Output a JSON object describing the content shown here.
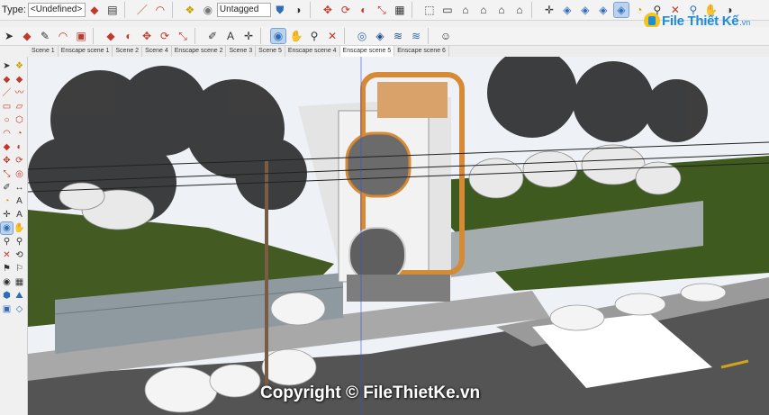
{
  "toolbar": {
    "type_label": "Type:",
    "type_value": "<Undefined>",
    "tag_value": "Untagged",
    "row1_icons": [
      "eraser-icon",
      "paint-bucket-icon",
      "line-tool-icon",
      "arc-tool-icon",
      "rectangle-icon",
      "circle-icon",
      "polygon-icon",
      "push-pull-icon",
      "move-icon",
      "rotate-icon",
      "scale-icon",
      "offset-icon",
      "follow-me-icon",
      "tape-measure-icon",
      "dimension-icon",
      "protractor-icon",
      "text-icon",
      "axes-icon",
      "3d-text-icon",
      "section-plane-icon",
      "iso-view-icon",
      "top-view-icon",
      "front-view-icon",
      "right-view-icon",
      "back-view-icon",
      "left-view-icon",
      "home-icon",
      "bottom-view-icon",
      "orbit-icon",
      "pan-icon",
      "zoom-icon",
      "zoom-window-icon",
      "zoom-extents-icon",
      "walk-icon",
      "look-around-icon",
      "position-camera-icon",
      "xray-icon",
      "shadows-icon",
      "fog-icon"
    ],
    "row2_icons": [
      "select-icon",
      "eraser-icon",
      "pencil-icon",
      "arc-icon",
      "shape-icon",
      "push-pull-icon",
      "move-icon",
      "rotate-icon",
      "scale-icon",
      "offset-icon",
      "tape-icon",
      "text-icon",
      "axes-icon",
      "orbit-icon",
      "pan-icon",
      "zoom-icon",
      "zoom-extents-icon",
      "previous-view-icon",
      "warehouse-icon",
      "extension-icon",
      "components-icon",
      "layers-icon",
      "account-icon"
    ]
  },
  "logo": {
    "text": "File Thiết Kế",
    "suffix": ".vn"
  },
  "scene_tabs": [
    "Scene 1",
    "Enscape scene 1",
    "Scene 2",
    "Scene 4",
    "Enscape scene 2",
    "Scene 3",
    "Scene 5",
    "Enscape scene 4",
    "Enscape scene 5",
    "Enscape scene 6"
  ],
  "selected_scene": "Enscape scene 5",
  "left_tools": [
    "select-icon",
    "component-icon",
    "paint-icon",
    "eraser-icon",
    "line-icon",
    "freehand-icon",
    "rectangle-icon",
    "rotated-rect-icon",
    "circle-icon",
    "polygon-icon",
    "arc-icon",
    "pie-icon",
    "push-pull-icon",
    "follow-me-icon",
    "move-icon",
    "rotate-icon",
    "scale-icon",
    "offset-icon",
    "tape-icon",
    "dimension-icon",
    "protractor-icon",
    "text-icon",
    "axes-icon",
    "3d-text-icon",
    "orbit-icon",
    "pan-icon",
    "zoom-icon",
    "zoom-window-icon",
    "zoom-extents-icon",
    "previous-icon",
    "position-camera-icon",
    "walk-icon",
    "look-around-icon",
    "section-icon",
    "sandbox-icon",
    "terrain-icon",
    "stamp-icon",
    "drape-icon"
  ],
  "watermark": "Copyright © FileThietKe.vn",
  "colors": {
    "sky": "#eef2f6",
    "grass": "#3f5a1e",
    "road": "#545454",
    "sidewalk": "#9a9a9a",
    "wall": "#8f9aa0",
    "house": "#f2f2f2",
    "accent_orange": "#d78a35"
  }
}
